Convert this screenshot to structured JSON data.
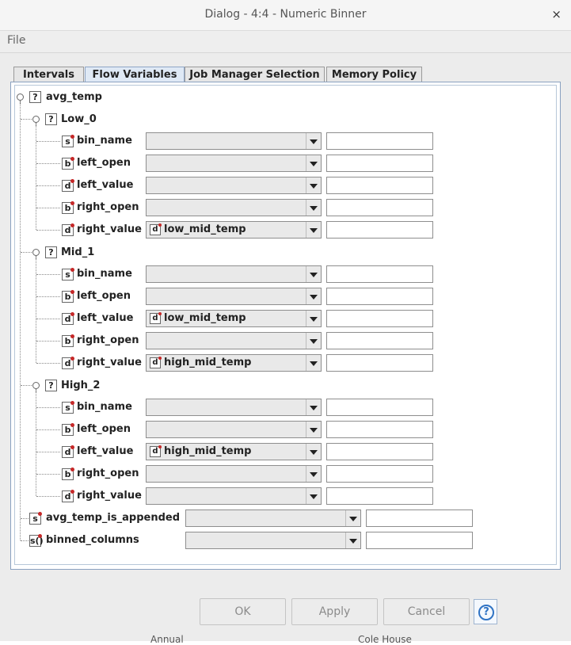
{
  "window": {
    "title": "Dialog - 4:4 - Numeric Binner",
    "close_symbol": "×"
  },
  "menu": {
    "file": "File"
  },
  "tabs": [
    {
      "label": "Intervals"
    },
    {
      "label": "Flow Variables",
      "active": true
    },
    {
      "label": "Job Manager Selection"
    },
    {
      "label": "Memory Policy"
    }
  ],
  "tree": {
    "root": {
      "label": "avg_temp",
      "icon": "?"
    },
    "bins": [
      {
        "label": "Low_0",
        "rows": [
          {
            "label": "bin_name",
            "type": "s",
            "value": ""
          },
          {
            "label": "left_open",
            "type": "b",
            "value": ""
          },
          {
            "label": "left_value",
            "type": "d",
            "value": ""
          },
          {
            "label": "right_open",
            "type": "b",
            "value": ""
          },
          {
            "label": "right_value",
            "type": "d",
            "value": "low_mid_temp"
          }
        ]
      },
      {
        "label": "Mid_1",
        "rows": [
          {
            "label": "bin_name",
            "type": "s",
            "value": ""
          },
          {
            "label": "left_open",
            "type": "b",
            "value": ""
          },
          {
            "label": "left_value",
            "type": "d",
            "value": "low_mid_temp"
          },
          {
            "label": "right_open",
            "type": "b",
            "value": ""
          },
          {
            "label": "right_value",
            "type": "d",
            "value": "high_mid_temp"
          }
        ]
      },
      {
        "label": "High_2",
        "rows": [
          {
            "label": "bin_name",
            "type": "s",
            "value": ""
          },
          {
            "label": "left_open",
            "type": "b",
            "value": ""
          },
          {
            "label": "left_value",
            "type": "d",
            "value": "high_mid_temp"
          },
          {
            "label": "right_open",
            "type": "b",
            "value": ""
          },
          {
            "label": "right_value",
            "type": "d",
            "value": ""
          }
        ]
      }
    ],
    "top_rows": [
      {
        "label": "avg_temp_is_appended",
        "type": "s",
        "value": ""
      },
      {
        "label": "binned_columns",
        "type": "s()",
        "value": ""
      }
    ]
  },
  "buttons": {
    "ok": "OK",
    "apply": "Apply",
    "cancel": "Cancel",
    "help": "?"
  },
  "bottom_partial_text": [
    "Annual",
    "Cole House"
  ]
}
